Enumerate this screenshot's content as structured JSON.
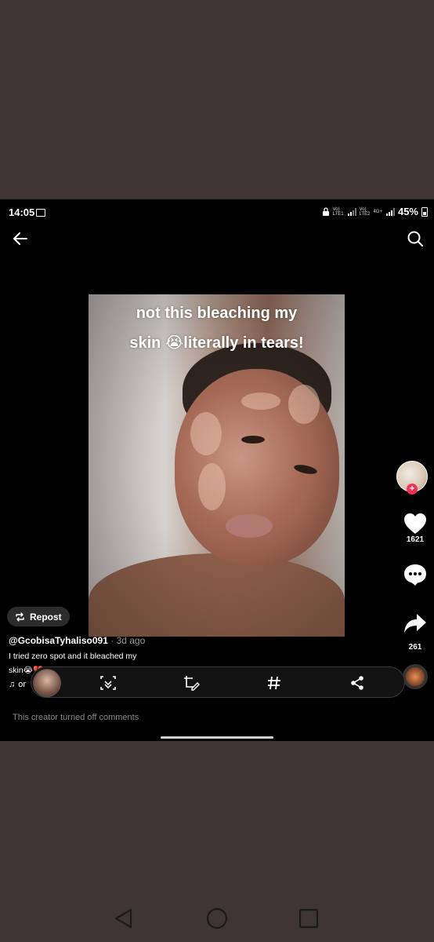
{
  "status_bar": {
    "time": "14:05",
    "net1_top": "Vo)",
    "net1_bottom": "LTE1",
    "net2_top": "Vo)",
    "net2_bottom": "LTE2",
    "net2_type": "4G+",
    "battery": "45%"
  },
  "video": {
    "caption_line1": "not this bleaching my",
    "caption_line2": "skin 😭literally in tears!"
  },
  "actions": {
    "like_count": "1621",
    "share_count": "261"
  },
  "repost_label": "Repost",
  "post": {
    "username": "@GcobisaTyhaliso091",
    "age": " · 3d ago",
    "description_line1": "I tried zero spot and it bleached my",
    "description_line2": "skin😭💔",
    "music": "or"
  },
  "comments_disabled": "This creator turned off comments",
  "colors": {
    "background": "#3f3536",
    "screen": "#000000",
    "accent_red": "#fe2c55"
  }
}
